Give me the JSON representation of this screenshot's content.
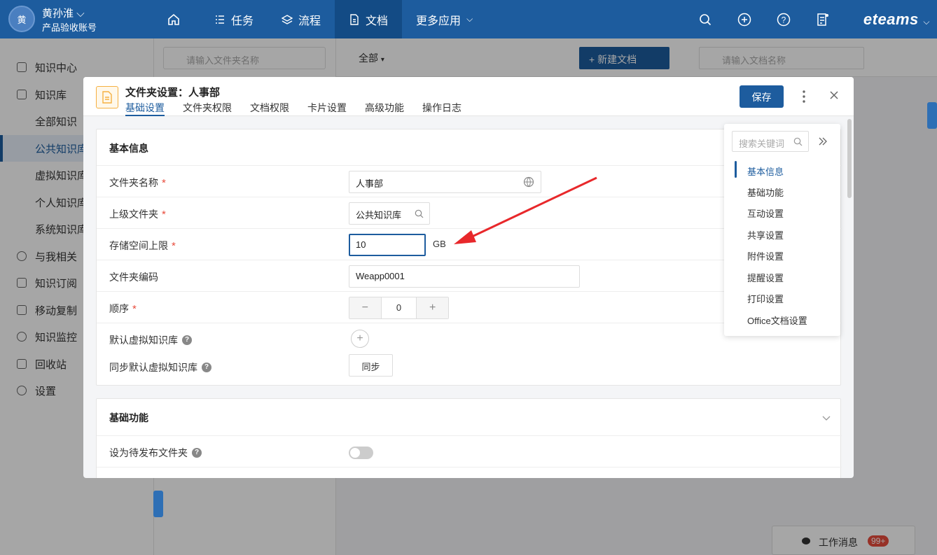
{
  "topbar": {
    "avatar_text": "黄",
    "username": "黄孙淮",
    "account": "产品验收账号",
    "nav": [
      {
        "label": ""
      },
      {
        "label": "任务"
      },
      {
        "label": "流程"
      },
      {
        "label": "文档"
      },
      {
        "label": "更多应用"
      }
    ],
    "brand": "eteams"
  },
  "sidebar": {
    "items": [
      {
        "label": "知识中心"
      },
      {
        "label": "知识库"
      },
      {
        "label": "全部知识"
      },
      {
        "label": "公共知识库"
      },
      {
        "label": "虚拟知识库"
      },
      {
        "label": "个人知识库"
      },
      {
        "label": "系统知识库"
      },
      {
        "label": "与我相关"
      },
      {
        "label": "知识订阅"
      },
      {
        "label": "移动复制"
      },
      {
        "label": "知识监控"
      },
      {
        "label": "回收站"
      },
      {
        "label": "设置"
      }
    ]
  },
  "folder_panel": {
    "search_placeholder": "请输入文件夹名称"
  },
  "content_toolbar": {
    "filter": "全部",
    "new_doc": "新建文档",
    "search_placeholder": "请输入文档名称"
  },
  "messages": {
    "label": "工作消息",
    "badge": "99+"
  },
  "modal": {
    "title": "文件夹设置：人事部",
    "tabs": [
      "基础设置",
      "文件夹权限",
      "文档权限",
      "卡片设置",
      "高级功能",
      "操作日志"
    ],
    "save": "保存",
    "basic": {
      "title": "基本信息",
      "folder_name_label": "文件夹名称",
      "folder_name_value": "人事部",
      "parent_label": "上级文件夹",
      "parent_value": "公共知识库",
      "storage_label": "存储空间上限",
      "storage_value": "10",
      "storage_unit": "GB",
      "code_label": "文件夹编码",
      "code_value": "Weapp0001",
      "order_label": "顺序",
      "order_value": "0",
      "default_virtual_label": "默认虚拟知识库",
      "sync_default_label": "同步默认虚拟知识库",
      "sync_btn": "同步"
    },
    "functions": {
      "title": "基础功能",
      "pending_label": "设为待发布文件夹"
    },
    "anchor": {
      "search_placeholder": "搜索关键词",
      "items": [
        "基本信息",
        "基础功能",
        "互动设置",
        "共享设置",
        "附件设置",
        "提醒设置",
        "打印设置",
        "Office文档设置"
      ]
    }
  }
}
